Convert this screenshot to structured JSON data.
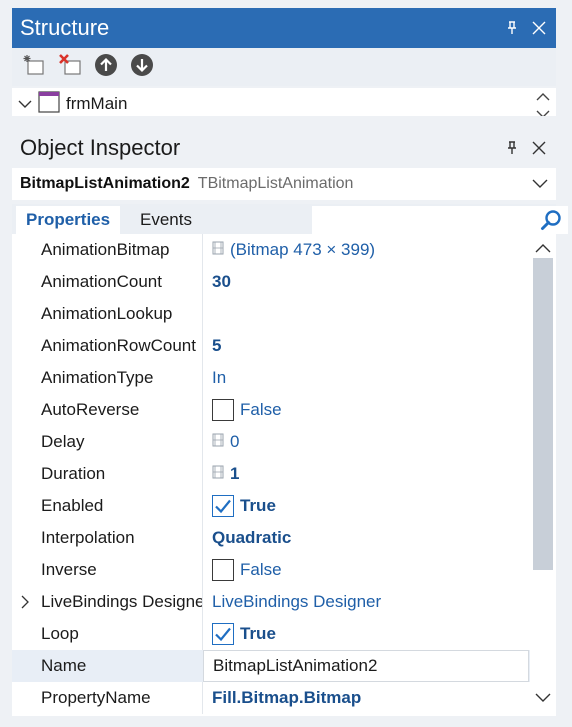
{
  "structure": {
    "title": "Structure",
    "toolbar": [
      {
        "icon": "new-item-icon"
      },
      {
        "icon": "delete-item-icon"
      },
      {
        "icon": "move-up-icon"
      },
      {
        "icon": "move-down-icon"
      }
    ],
    "tree_item": "frmMain"
  },
  "inspector": {
    "title": "Object Inspector",
    "selected_object": "BitmapListAnimation2",
    "selected_type": "TBitmapListAnimation",
    "tabs": {
      "properties": "Properties",
      "events": "Events"
    },
    "search_placeholder": "",
    "properties": [
      {
        "name": "AnimationBitmap",
        "value": "(Bitmap 473 × 399)"
      },
      {
        "name": "AnimationCount",
        "value": "30"
      },
      {
        "name": "AnimationLookup",
        "value": ""
      },
      {
        "name": "AnimationRowCount",
        "value": "5"
      },
      {
        "name": "AnimationType",
        "value": "In"
      },
      {
        "name": "AutoReverse",
        "value": "False"
      },
      {
        "name": "Delay",
        "value": "0"
      },
      {
        "name": "Duration",
        "value": "1"
      },
      {
        "name": "Enabled",
        "value": "True"
      },
      {
        "name": "Interpolation",
        "value": "Quadratic"
      },
      {
        "name": "Inverse",
        "value": "False"
      },
      {
        "name": "LiveBindings Designer",
        "value": "LiveBindings Designer"
      },
      {
        "name": "Loop",
        "value": "True"
      },
      {
        "name": "Name",
        "value": "BitmapListAnimation2"
      },
      {
        "name": "PropertyName",
        "value": "Fill.Bitmap.Bitmap"
      }
    ]
  },
  "colors": {
    "structure_header_bg": "#2b6cb4",
    "value_text": "#1f5fa8",
    "checkbox_accent": "#1f6ec2"
  }
}
